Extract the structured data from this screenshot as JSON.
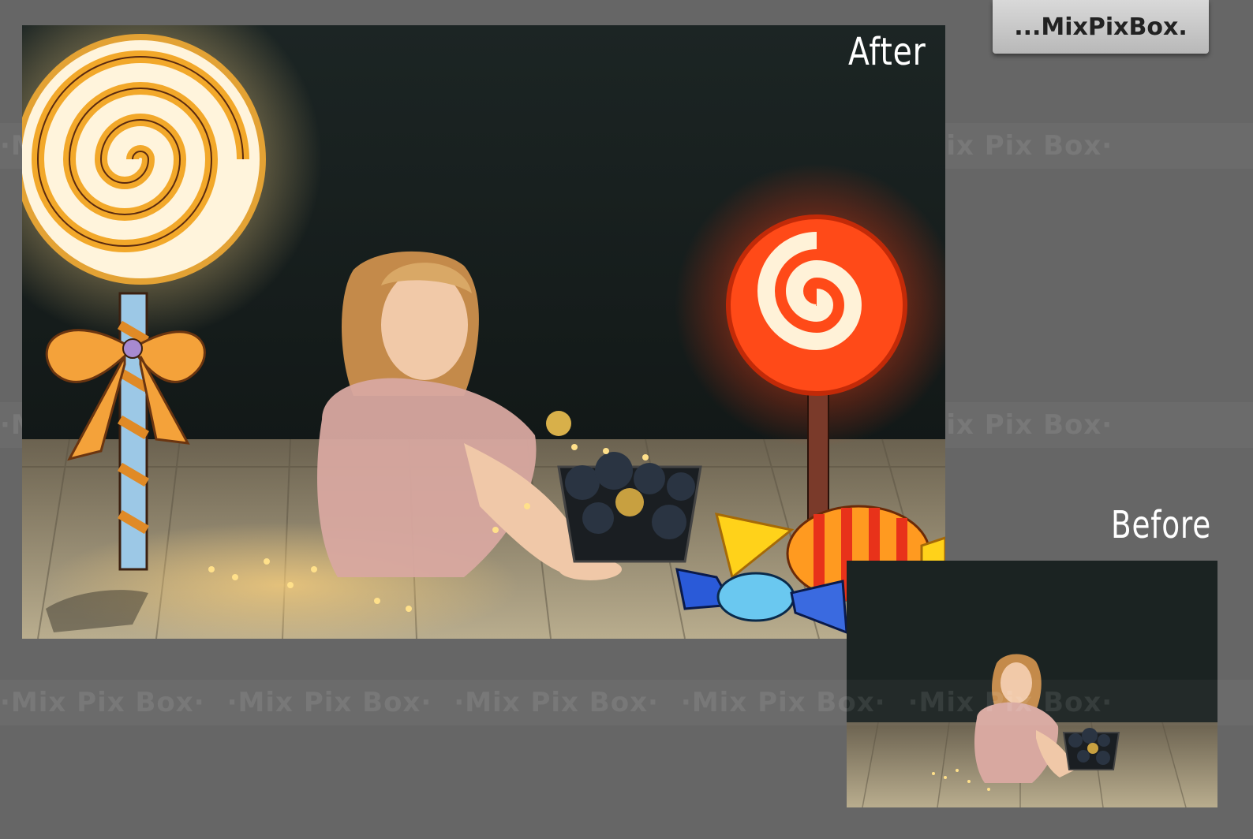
{
  "brand": {
    "logo_text": "...MixPixBox."
  },
  "labels": {
    "after": "After",
    "before": "Before"
  },
  "watermark": {
    "text": "·Mix Pix Box·"
  },
  "colors": {
    "background": "#666666",
    "label": "#ffffff",
    "badge": "#c8c8c8"
  }
}
